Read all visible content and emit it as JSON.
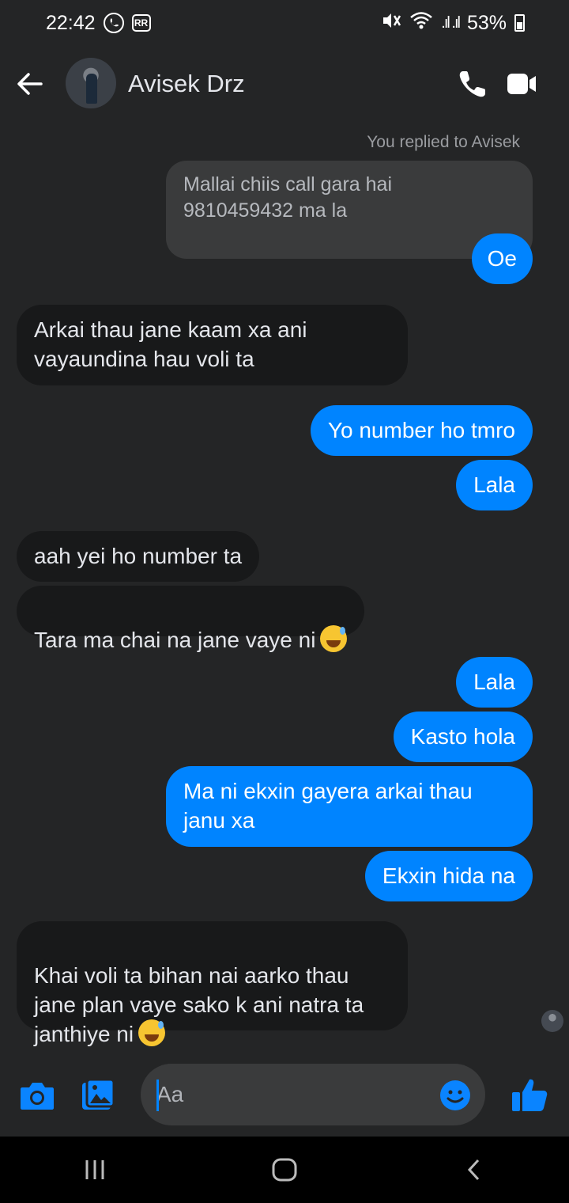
{
  "status_bar": {
    "time": "22:42",
    "badge_viber": "",
    "badge_rr": "RR",
    "battery": "53%",
    "signal": ".ıl .ıl"
  },
  "header": {
    "contact_name": "Avisek Drz"
  },
  "reply": {
    "note": "You replied to Avisek",
    "quoted_text": "Mallai chiis call gara hai\n9810459432 ma la"
  },
  "messages": [
    {
      "dir": "out",
      "text": "Oe"
    },
    {
      "dir": "in",
      "text": "Arkai thau jane kaam xa ani\nvayaundina hau voli ta"
    },
    {
      "dir": "out",
      "text": "Yo number ho tmro"
    },
    {
      "dir": "out",
      "text": "Lala"
    },
    {
      "dir": "in",
      "text": "aah yei ho number ta"
    },
    {
      "dir": "in",
      "text": "Tara ma chai na jane vaye ni"
    },
    {
      "dir": "out",
      "text": "Lala"
    },
    {
      "dir": "out",
      "text": "Kasto hola"
    },
    {
      "dir": "out",
      "text": "Ma ni ekxin gayera arkai thau\njanu xa"
    },
    {
      "dir": "out",
      "text": "Ekxin hida na"
    },
    {
      "dir": "in",
      "text": "Khai voli ta bihan nai aarko thau\njane plan vaye sako k ani natra ta\njanthiye ni"
    }
  ],
  "composer": {
    "placeholder": "Aa"
  },
  "icons": {
    "back": "arrow-left-icon",
    "call": "phone-icon",
    "video": "video-camera-icon",
    "camera": "camera-icon",
    "gallery": "image-icon",
    "emoji": "smiley-icon",
    "like": "thumbs-up-icon"
  },
  "colors": {
    "background": "#242526",
    "outgoing_bubble": "#0084ff",
    "incoming_bubble": "#18191a",
    "accent": "#0084ff"
  }
}
